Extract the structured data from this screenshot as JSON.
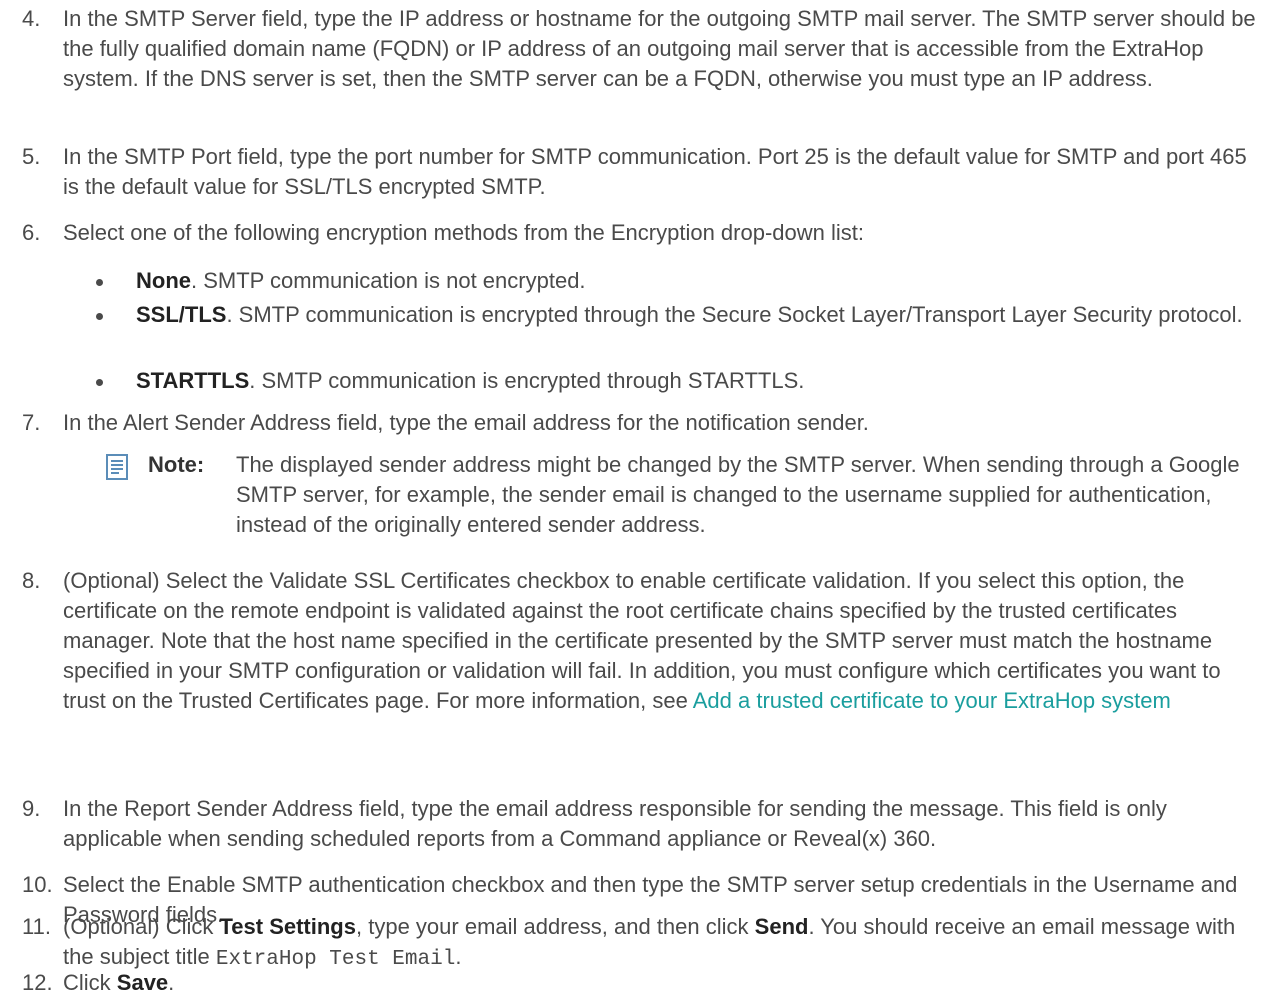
{
  "steps": {
    "s4": {
      "num": "4.",
      "a": "In the SMTP Server field, type the IP address or hostname for the outgoing SMTP mail server. The SMTP server should be the fully qualified domain name (FQDN) or IP address of an outgoing mail server that is accessible from the ExtraHop system. If the DNS server is set, then the SMTP server can be a FQDN, otherwise you must type an IP address."
    },
    "s5": {
      "num": "5.",
      "a": "In the SMTP Port field, type the port number for SMTP communication. Port 25 is the default value for SMTP and port 465 is the default value for SSL/TLS encrypted SMTP."
    },
    "s6": {
      "num": "6.",
      "a": "Select one of the following encryption methods from the Encryption drop-down list:",
      "bullets": [
        {
          "term": "None",
          "desc": ". SMTP communication is not encrypted."
        },
        {
          "term": "SSL/TLS",
          "desc": ". SMTP communication is encrypted through the Secure Socket Layer/Transport Layer Security protocol."
        },
        {
          "term": "STARTTLS",
          "desc": ". SMTP communication is encrypted through STARTTLS."
        }
      ]
    },
    "s7": {
      "num": "7.",
      "a": "In the Alert Sender Address field, type the email address for the notification sender.",
      "note_label": "Note:",
      "note_text": "The displayed sender address might be changed by the SMTP server. When sending through a Google SMTP server, for example, the sender email is changed to the username supplied for authentication, instead of the originally entered sender address."
    },
    "s8": {
      "num": "8.",
      "a": "(Optional) Select the Validate SSL Certificates checkbox to enable certificate validation. If you select this option, the certificate on the remote endpoint is validated against the root certificate chains specified by the trusted certificates manager. Note that the host name specified in the certificate presented by the SMTP server must match the hostname specified in your SMTP configuration or validation will fail. In addition, you must configure which certificates you want to trust on the Trusted Certificates page. For more information, see ",
      "link": "Add a trusted certificate to your ExtraHop system"
    },
    "s9": {
      "num": "9.",
      "a": "In the Report Sender Address field, type the email address responsible for sending the message. This field is only applicable when sending scheduled reports from a Command appliance or Reveal(x) 360."
    },
    "s10": {
      "num": "10.",
      "a": "Select the Enable SMTP authentication checkbox and then type the SMTP server setup credentials in the Username and Password fields."
    },
    "s11": {
      "num": "11.",
      "a": "(Optional) Click ",
      "b1": "Test Settings",
      "c": ", type your email address, and then click ",
      "b2": "Send",
      "d": ". You should receive an email message with the subject title ",
      "code": "ExtraHop Test Email",
      "e": "."
    },
    "s12": {
      "num": "12.",
      "a": "Click ",
      "b": "Save",
      "c": "."
    }
  }
}
